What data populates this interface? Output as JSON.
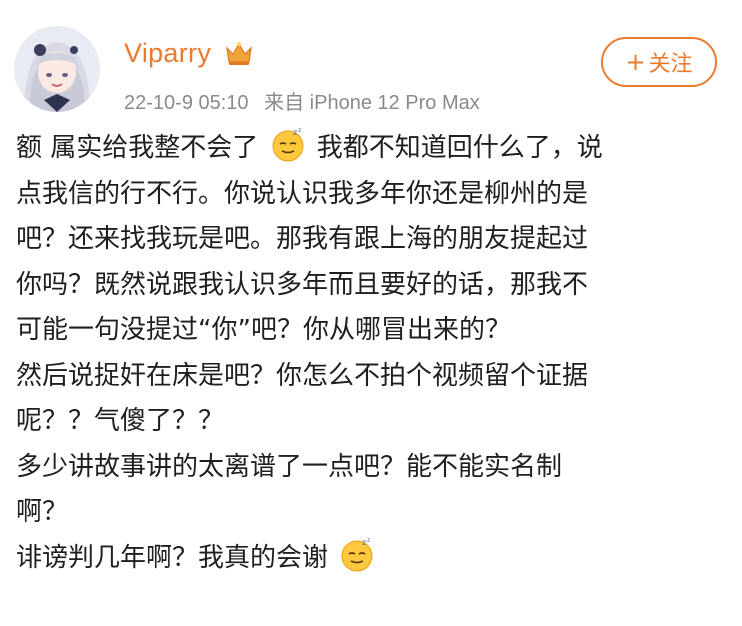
{
  "user": {
    "name": "Viparry",
    "timestamp": "22-10-9 05:10",
    "source": "来自 iPhone 12 Pro Max"
  },
  "follow_button": {
    "label": "关注"
  },
  "post": {
    "lines": [
      {
        "before": "额 属实给我整不会了",
        "after": "我都不知道回什么了，说"
      },
      {
        "text": "点我信的行不行。你说认识我多年你还是柳州的是"
      },
      {
        "text": "吧？还来找我玩是吧。那我有跟上海的朋友提起过"
      },
      {
        "text": "你吗？既然说跟我认识多年而且要好的话，那我不"
      },
      {
        "text": "可能一句没提过“你”吧？你从哪冒出来的？"
      },
      {
        "text": "然后说捉奸在床是吧？你怎么不拍个视频留个证据"
      },
      {
        "text": "呢？？气傻了？？"
      },
      {
        "text": "多少讲故事讲的太离谱了一点吧？能不能实名制"
      },
      {
        "text": "啊？"
      },
      {
        "before": "诽谤判几年啊？我真的会谢",
        "after": ""
      }
    ]
  },
  "icons": [
    "avatar",
    "vip-crown-icon",
    "plus-icon",
    "sleepy-emoji-icon"
  ],
  "colors": {
    "accent": "#ec7a2c",
    "meta": "#8a8a8a",
    "text": "#1f1f1f"
  }
}
